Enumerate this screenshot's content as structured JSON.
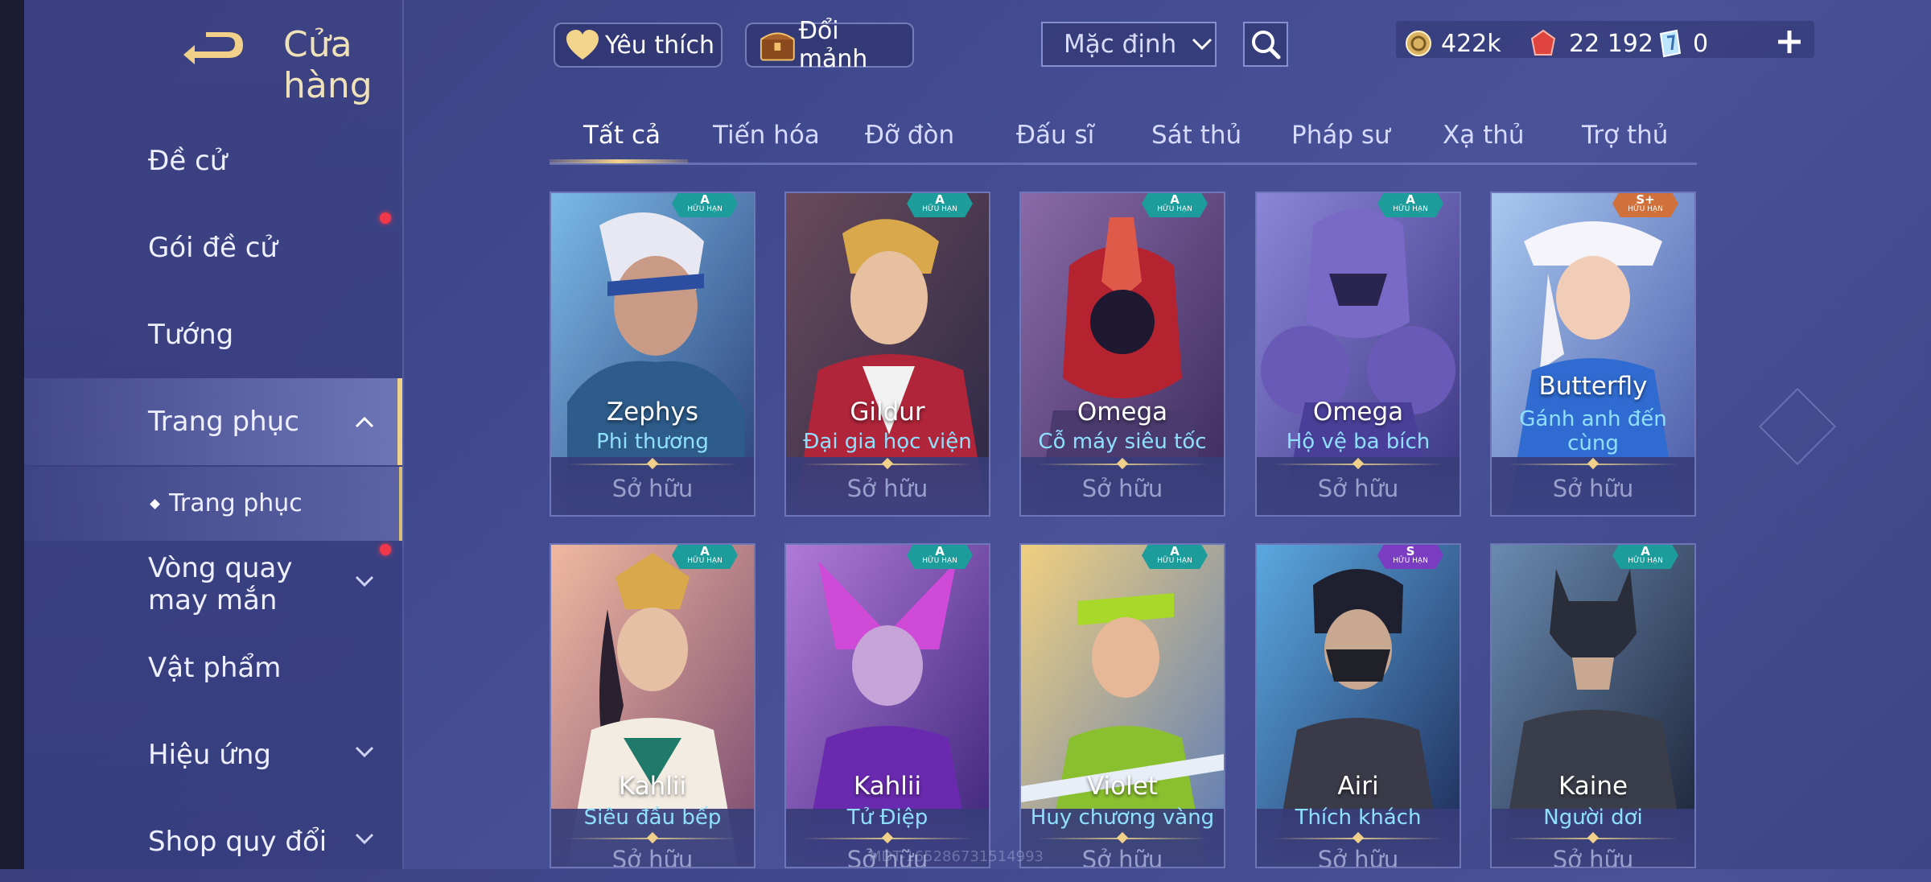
{
  "header": {
    "title": "Cửa hàng",
    "favorite_label": "Yêu thích",
    "exchange_label": "Đổi mảnh",
    "sort_value": "Mặc định"
  },
  "currencies": [
    {
      "icon": "gold-coin-icon",
      "value": "422k"
    },
    {
      "icon": "red-gem-icon",
      "value": "22 192"
    },
    {
      "icon": "voucher-icon",
      "value": "0"
    }
  ],
  "sidebar": {
    "items": [
      {
        "label": "Đề cử"
      },
      {
        "label": "Gói đề cử"
      },
      {
        "label": "Tướng"
      },
      {
        "label": "Trang phục"
      },
      {
        "label": "Trang phục"
      },
      {
        "label": "Vòng quay may mắn"
      },
      {
        "label": "Vật phẩm"
      },
      {
        "label": "Hiệu ứng"
      },
      {
        "label": "Shop quy đổi"
      }
    ]
  },
  "tabs": [
    "Tất cả",
    "Tiến hóa",
    "Đỡ đòn",
    "Đấu sĩ",
    "Sát thủ",
    "Pháp sư",
    "Xạ thủ",
    "Trợ thủ"
  ],
  "cards": [
    {
      "hero": "Zephys",
      "skin": "Phi thương",
      "status": "Sở hữu",
      "rank": "A",
      "rank_sub": "HỮU HẠN"
    },
    {
      "hero": "Gildur",
      "skin": "Đại gia học viện",
      "status": "Sở hữu",
      "rank": "A",
      "rank_sub": "HỮU HẠN"
    },
    {
      "hero": "Omega",
      "skin": "Cỗ máy siêu tốc",
      "status": "Sở hữu",
      "rank": "A",
      "rank_sub": "HỮU HẠN"
    },
    {
      "hero": "Omega",
      "skin": "Hộ vệ ba bích",
      "status": "Sở hữu",
      "rank": "A",
      "rank_sub": "HỮU HẠN"
    },
    {
      "hero": "Butterfly",
      "skin": "Gánh anh đến cùng",
      "status": "Sở hữu",
      "rank": "S+",
      "rank_sub": "HỮU HẠN"
    },
    {
      "hero": "Kahlii",
      "skin": "Siêu đầu bếp",
      "status": "Sở hữu",
      "rank": "A",
      "rank_sub": "HỮU HẠN"
    },
    {
      "hero": "Kahlii",
      "skin": "Tử Điệp",
      "status": "Sở hữu",
      "rank": "A",
      "rank_sub": "HỮU HẠN"
    },
    {
      "hero": "Violet",
      "skin": "Huy chương vàng",
      "status": "Sở hữu",
      "rank": "A",
      "rank_sub": "HỮU HẠN"
    },
    {
      "hero": "Airi",
      "skin": "Thích khách",
      "status": "Sở hữu",
      "rank": "S",
      "rank_sub": "HỮU HẠN"
    },
    {
      "hero": "Kaine",
      "skin": "Người dơi",
      "status": "Sở hữu",
      "rank": "A",
      "rank_sub": "HỮU HẠN"
    }
  ],
  "watermark": "MDT-165286731514993",
  "colors": {
    "accent_gold": "#f1d18a",
    "skin_name": "#8fe0ff",
    "notification": "#f0384a",
    "rank_a": "#1c9c9a",
    "rank_s": "#7a3cc0",
    "rank_splus": "#d0703a"
  }
}
